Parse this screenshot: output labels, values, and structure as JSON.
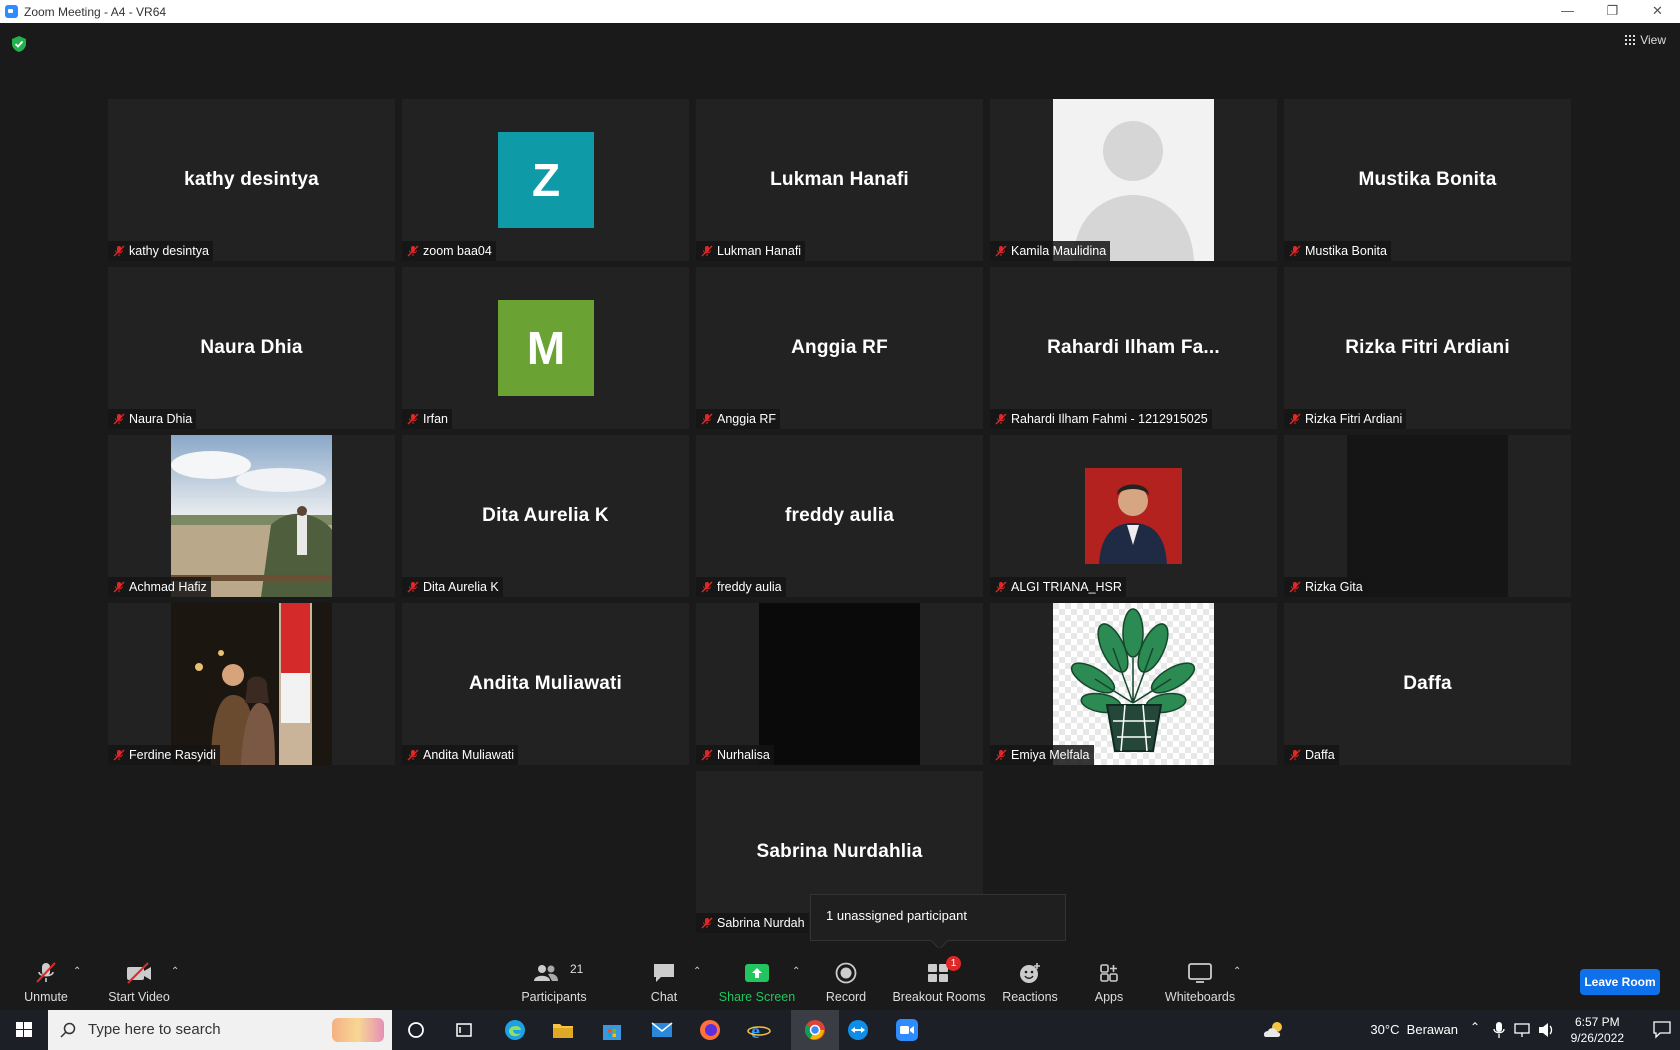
{
  "window": {
    "title": "Zoom Meeting - A4 - VR64",
    "minimize": "—",
    "restore": "❐",
    "close": "✕"
  },
  "view_label": "View",
  "participants": [
    {
      "big": "kathy desintya",
      "label": "kathy desintya"
    },
    {
      "big": "",
      "label": "zoom baa04",
      "letter": "Z",
      "letter_color": "#0e9aa7"
    },
    {
      "big": "Lukman Hanafi",
      "label": "Lukman Hanafi"
    },
    {
      "big": "",
      "label": "Kamila Maulidina",
      "photo": "silhouette"
    },
    {
      "big": "Mustika Bonita",
      "label": "Mustika Bonita"
    },
    {
      "big": "Naura Dhia",
      "label": "Naura Dhia"
    },
    {
      "big": "",
      "label": "Irfan",
      "letter": "M",
      "letter_color": "#6aa334"
    },
    {
      "big": "Anggia RF",
      "label": "Anggia RF"
    },
    {
      "big": "Rahardi  Ilham  Fa...",
      "label": "Rahardi Ilham Fahmi - 1212915025"
    },
    {
      "big": "Rizka Fitri Ardiani",
      "label": "Rizka Fitri Ardiani"
    },
    {
      "big": "",
      "label": "Achmad Hafiz",
      "photo": "landscape"
    },
    {
      "big": "Dita Aurelia K",
      "label": "Dita Aurelia K"
    },
    {
      "big": "freddy aulia",
      "label": "freddy aulia"
    },
    {
      "big": "",
      "label": "ALGI TRIANA_HSR",
      "photo": "portrait"
    },
    {
      "big": "",
      "label": "Rizka Gita",
      "photo": "dark"
    },
    {
      "big": "",
      "label": "Ferdine Rasyidi",
      "photo": "couple"
    },
    {
      "big": "Andita Muliawati",
      "label": "Andita Muliawati"
    },
    {
      "big": "",
      "label": "Nurhalisa",
      "photo": "black"
    },
    {
      "big": "",
      "label": "Emiya Melfala",
      "photo": "plant"
    },
    {
      "big": "Daffa",
      "label": "Daffa"
    },
    {
      "big": "Sabrina Nurdahlia",
      "label": "Sabrina Nurdah"
    }
  ],
  "tooltip": "1 unassigned participant",
  "toolbar": {
    "unmute": "Unmute",
    "start_video": "Start Video",
    "participants": "Participants",
    "participants_count": "21",
    "chat": "Chat",
    "share_screen": "Share Screen",
    "record": "Record",
    "breakout_rooms": "Breakout Rooms",
    "breakout_badge": "1",
    "reactions": "Reactions",
    "apps": "Apps",
    "whiteboards": "Whiteboards",
    "leave": "Leave Room"
  },
  "taskbar": {
    "search_placeholder": "Type here to search",
    "weather": "30°C  Berawan",
    "time": "6:57 PM",
    "date": "9/26/2022"
  },
  "colors": {
    "accent": "#0e71eb",
    "share_green": "#22c55e",
    "badge_red": "#e02828",
    "muted_red": "#e02828"
  }
}
